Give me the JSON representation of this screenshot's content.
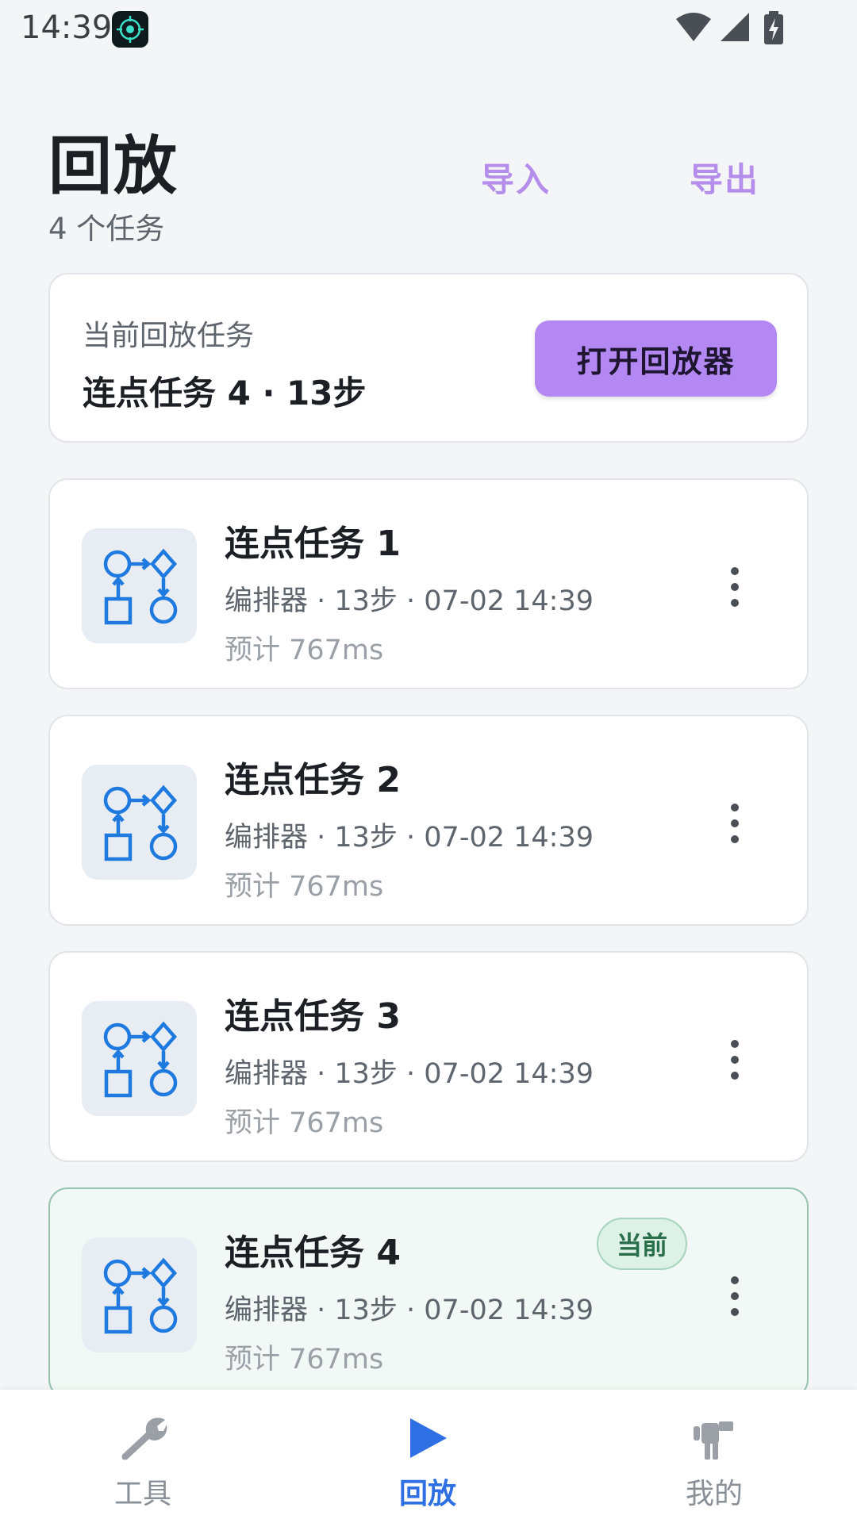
{
  "status_bar": {
    "time": "14:39",
    "icons": [
      "app-target-icon",
      "wifi-icon",
      "signal-icon",
      "battery-charging-icon"
    ]
  },
  "header": {
    "title": "回放",
    "subtitle": "4 个任务",
    "import_label": "导入",
    "export_label": "导出"
  },
  "current_task": {
    "label": "当前回放任务",
    "value": "连点任务 4 · 13步",
    "open_button_label": "打开回放器"
  },
  "tasks": [
    {
      "name": "连点任务 1",
      "meta": "编排器 · 13步 · 07-02 14:39",
      "eta": "预计 767ms",
      "icon": "flowchart-icon",
      "current": false
    },
    {
      "name": "连点任务 2",
      "meta": "编排器 · 13步 · 07-02 14:39",
      "eta": "预计 767ms",
      "icon": "flowchart-icon",
      "current": false
    },
    {
      "name": "连点任务 3",
      "meta": "编排器 · 13步 · 07-02 14:39",
      "eta": "预计 767ms",
      "icon": "flowchart-icon",
      "current": false
    },
    {
      "name": "连点任务 4",
      "meta": "编排器 · 13步 · 07-02 14:39",
      "eta": "预计 767ms",
      "icon": "flowchart-icon",
      "current": true,
      "badge": "当前"
    }
  ],
  "bottom_nav": {
    "items": [
      {
        "label": "工具",
        "icon": "wrench-icon",
        "active": false
      },
      {
        "label": "回放",
        "icon": "play-icon",
        "active": true
      },
      {
        "label": "我的",
        "icon": "user-icon",
        "active": false
      }
    ]
  },
  "colors": {
    "accent_purple": "#B488F3",
    "header_action": "#B58DEB",
    "active_nav": "#2F6FE4",
    "icon_blue": "#1F7AE0",
    "current_badge_bg": "#DDF1E6",
    "current_badge_text": "#2A6F4B"
  }
}
